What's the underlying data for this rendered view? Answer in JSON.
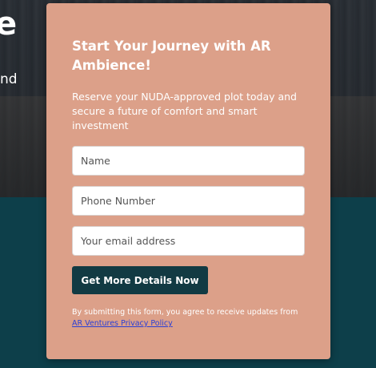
{
  "hero": {
    "fragment_big": "e",
    "fragment_small": "nd"
  },
  "form": {
    "title": "Start Your Journey with AR Ambience!",
    "subtitle": "Reserve your NUDA-approved plot today and secure a future of comfort and smart investment",
    "fields": {
      "name_placeholder": "Name",
      "phone_placeholder": "Phone Number",
      "email_placeholder": "Your email address"
    },
    "submit_label": "Get More Details Now",
    "consent_text": "By submitting this form, you agree to receive updates from ",
    "consent_link": "AR Ventures Privacy Policy"
  },
  "colors": {
    "card_background": "#dca089",
    "button_background": "#123a43",
    "lower_background": "#0d3f4a",
    "link": "#2a3fd6"
  }
}
